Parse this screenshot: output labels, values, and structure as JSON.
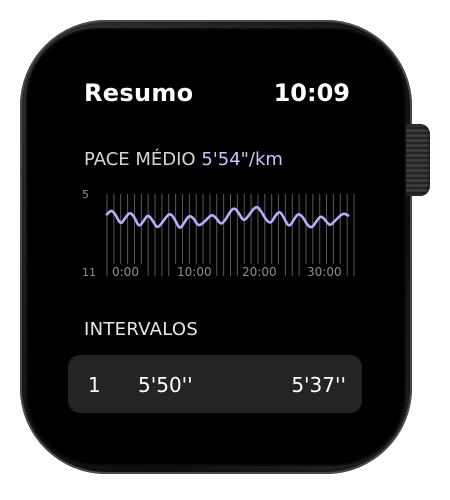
{
  "header": {
    "title": "Resumo",
    "time": "10:09"
  },
  "metric": {
    "label": "PACE MÉDIO",
    "value": "5'54\"/km"
  },
  "chart_data": {
    "type": "line",
    "y_tick_labels": [
      "5",
      "11"
    ],
    "x_tick_labels": [
      "0:00",
      "10:00",
      "20:00",
      "30:00"
    ],
    "xlim": [
      0,
      38
    ],
    "ylim": [
      5,
      11
    ],
    "grid": true,
    "line_color": "#b7adfa",
    "x": [
      0,
      0.7,
      1.4,
      2.1,
      2.8,
      3.5,
      4.2,
      4.9,
      5.6,
      6.3,
      7.0,
      7.7,
      8.4,
      9.1,
      9.8,
      10.5,
      11.2,
      11.9,
      12.6,
      13.3,
      14.0,
      14.7,
      15.4,
      16.1,
      16.8,
      17.5,
      18.2,
      18.9,
      19.6,
      20.3,
      21.0,
      21.7,
      22.4,
      23.1,
      23.8,
      24.5,
      25.2,
      25.9,
      26.6,
      27.3,
      28.0,
      28.7,
      29.4,
      30.1,
      30.8,
      31.5,
      32.2,
      32.9,
      33.6,
      34.3,
      35.0,
      35.7,
      36.4,
      37.1
    ],
    "y": [
      6.4,
      6.0,
      6.5,
      7.3,
      6.7,
      6.2,
      6.6,
      7.5,
      7.0,
      6.4,
      6.9,
      7.6,
      7.2,
      6.6,
      6.3,
      6.9,
      7.7,
      7.1,
      6.5,
      6.7,
      7.4,
      7.2,
      6.8,
      6.4,
      6.7,
      7.3,
      6.9,
      6.2,
      5.8,
      6.3,
      7.0,
      6.6,
      6.0,
      5.7,
      6.2,
      6.9,
      7.2,
      6.5,
      6.1,
      6.8,
      7.5,
      6.9,
      6.3,
      6.6,
      7.3,
      7.6,
      7.0,
      6.5,
      6.9,
      7.4,
      7.0,
      6.6,
      6.3,
      6.5
    ]
  },
  "intervals": {
    "heading": "INTERVALOS",
    "rows": [
      {
        "index": "1",
        "pace": "5'50''",
        "time": "5'37''"
      }
    ]
  }
}
